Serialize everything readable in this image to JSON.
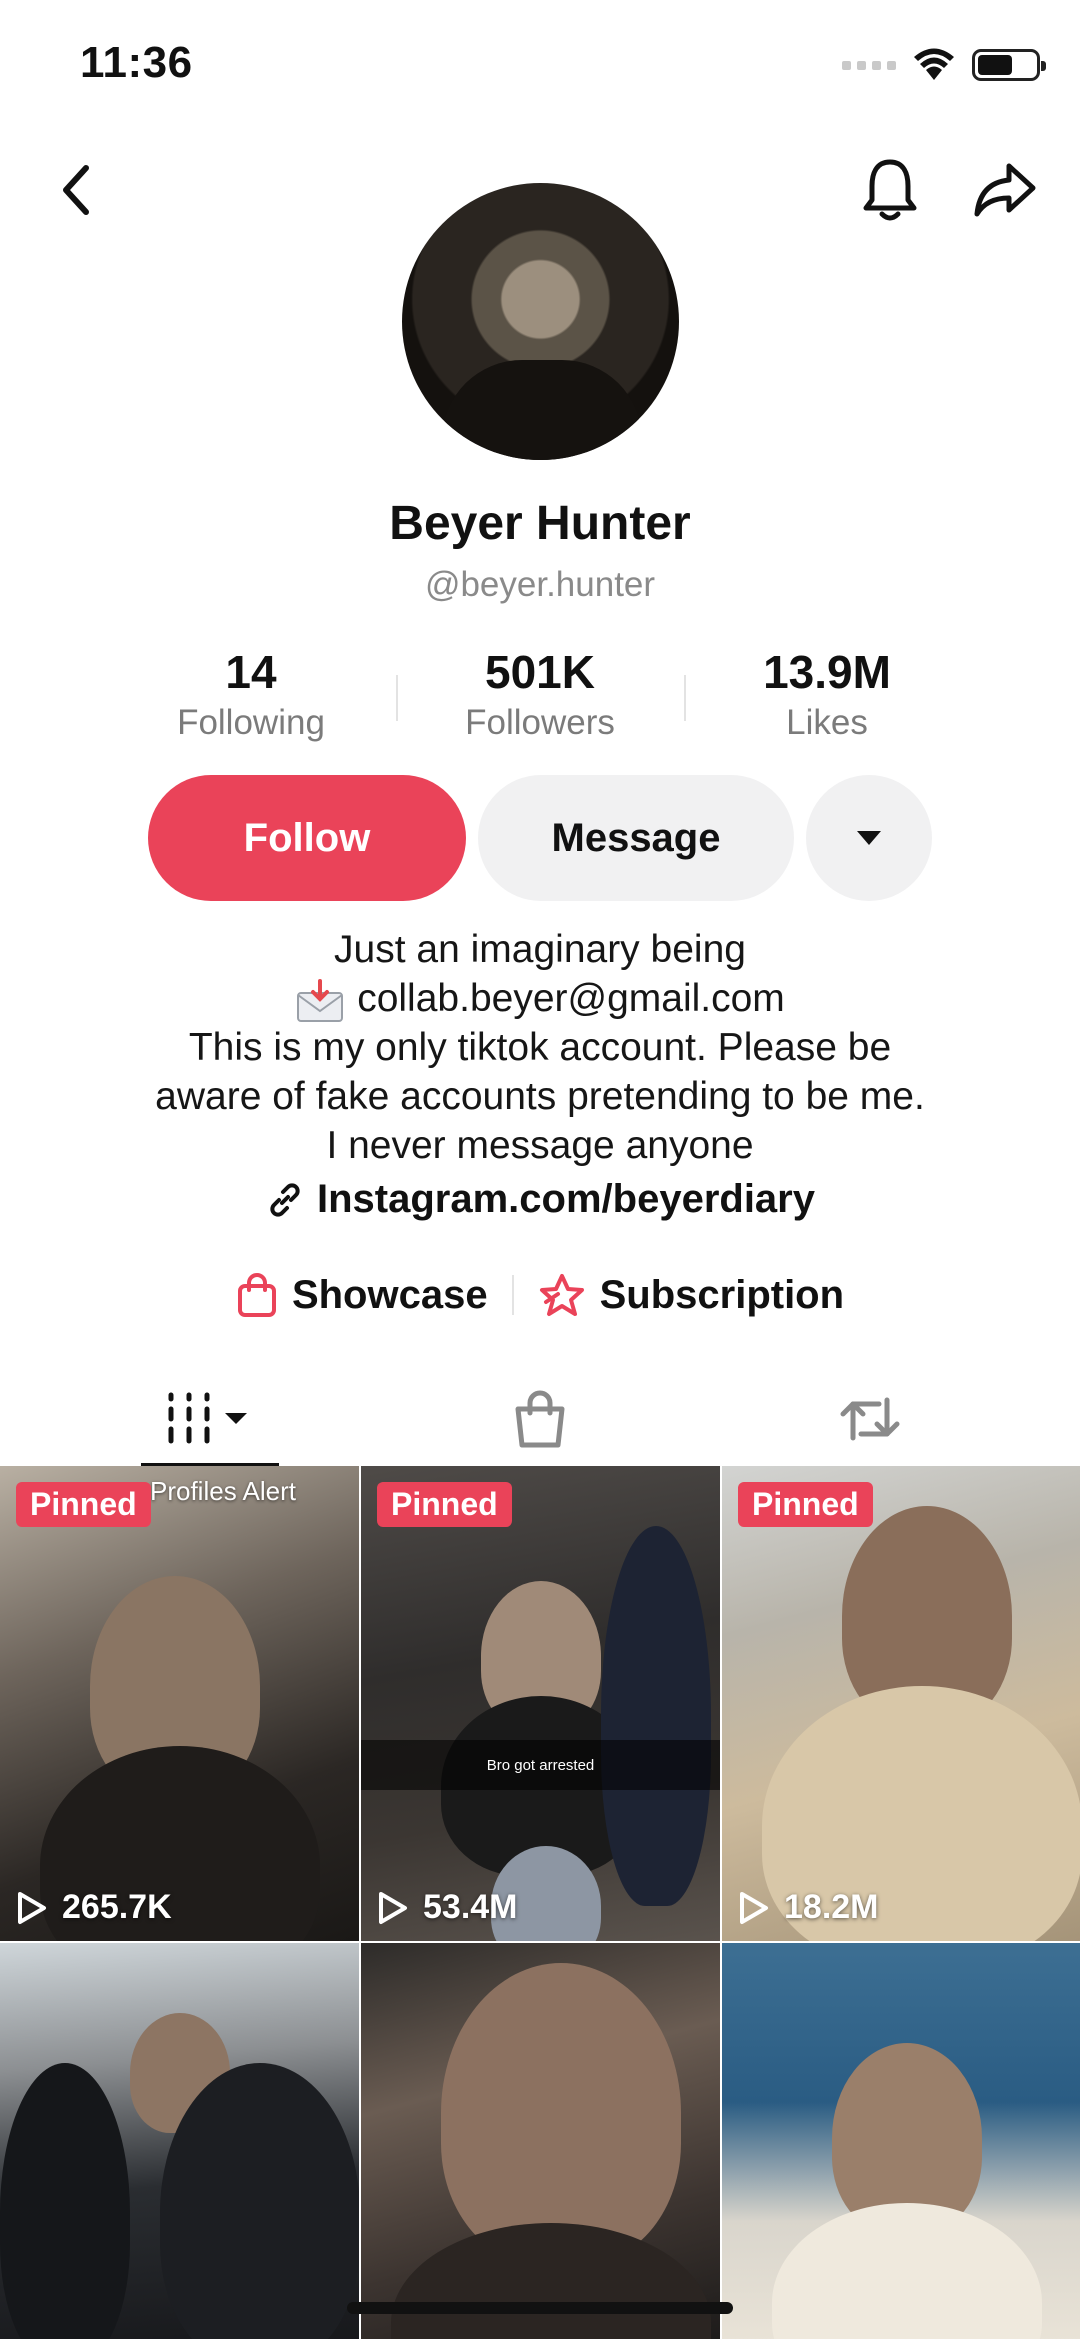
{
  "status_bar": {
    "time": "11:36"
  },
  "profile": {
    "display_name": "Beyer Hunter",
    "username": "@beyer.hunter"
  },
  "stats": [
    {
      "value": "14",
      "label": "Following"
    },
    {
      "value": "501K",
      "label": "Followers"
    },
    {
      "value": "13.9M",
      "label": "Likes"
    }
  ],
  "actions": {
    "follow_label": "Follow",
    "message_label": "Message"
  },
  "bio": {
    "line1": "Just an imaginary being",
    "email": "collab.beyer@gmail.com",
    "line3": "This is my only tiktok account. Please be",
    "line4": "aware of fake accounts pretending to be me.",
    "line5": "I never message anyone",
    "link": "Instagram.com/beyerdiary"
  },
  "shop_row": {
    "showcase_label": "Showcase",
    "subscription_label": "Subscription"
  },
  "videos": [
    {
      "pinned_label": "Pinned",
      "overlay_text": "Profiles Alert",
      "views": "265.7K"
    },
    {
      "pinned_label": "Pinned",
      "caption": "Bro got arrested",
      "views": "53.4M"
    },
    {
      "pinned_label": "Pinned",
      "views": "18.2M"
    },
    {},
    {},
    {}
  ],
  "colors": {
    "accent": "#ea4359",
    "secondary_button": "#f1f1f2",
    "muted_text": "#8a8a8a"
  }
}
